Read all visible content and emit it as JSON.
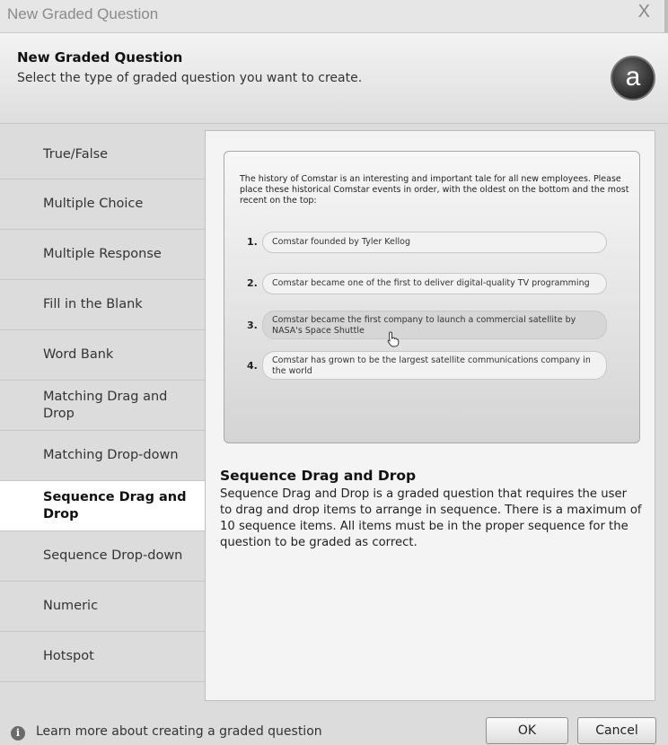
{
  "window": {
    "title": "New Graded Question",
    "close_label": "X"
  },
  "header": {
    "title": "New Graded Question",
    "subtitle": "Select the type of graded question you want to create.",
    "logo_letter": "a"
  },
  "sidebar": {
    "items": [
      {
        "label": "True/False"
      },
      {
        "label": "Multiple Choice"
      },
      {
        "label": "Multiple Response"
      },
      {
        "label": "Fill in the Blank"
      },
      {
        "label": "Word Bank"
      },
      {
        "label": "Matching Drag and Drop"
      },
      {
        "label": "Matching Drop-down"
      },
      {
        "label": "Sequence Drag and Drop",
        "selected": true
      },
      {
        "label": "Sequence Drop-down"
      },
      {
        "label": "Numeric"
      },
      {
        "label": "Hotspot"
      }
    ]
  },
  "preview": {
    "prompt": "The history of Comstar is an interesting and important tale for all new employees. Please place these historical Comstar events in order, with the oldest on the bottom and the most recent on the top:",
    "items": [
      {
        "number": "1.",
        "text": "Comstar founded by Tyler Kellog"
      },
      {
        "number": "2.",
        "text": "Comstar became one of the first to deliver digital-quality TV programming"
      },
      {
        "number": "3.",
        "text": "Comstar became the first company to launch a commercial satellite by NASA's Space Shuttle"
      },
      {
        "number": "4.",
        "text": "Comstar has grown to be the largest satellite communications company in the world"
      }
    ]
  },
  "description": {
    "title": "Sequence Drag and Drop",
    "body": "Sequence Drag and Drop is a graded question that requires the user to drag and drop items to arrange in sequence. There is a maximum of 10 sequence items. All items must be in the proper sequence for the question to be graded as correct."
  },
  "footer": {
    "info_icon": "info-icon",
    "learn_more": "Learn more about creating a graded question",
    "ok_label": "OK",
    "cancel_label": "Cancel"
  }
}
